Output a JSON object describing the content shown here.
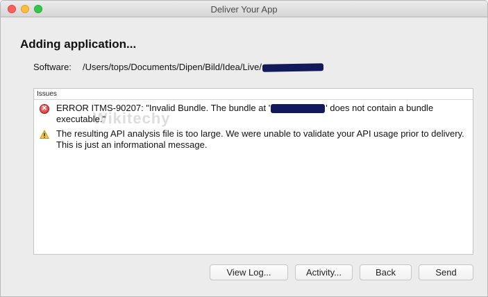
{
  "window": {
    "title": "Deliver Your App"
  },
  "heading": "Adding application...",
  "software": {
    "label": "Software:",
    "path": "/Users/tops/Documents/Dipen/Bild/Idea/Live/"
  },
  "issues": {
    "header": "Issues",
    "items": [
      {
        "type": "error",
        "icon": "error-icon",
        "text_before": "ERROR ITMS-90207: \"Invalid Bundle. The bundle at '",
        "text_after": "' does not contain a bundle executable.\""
      },
      {
        "type": "warning",
        "icon": "warning-icon",
        "text": "The resulting API analysis file is too large.  We were unable to validate your API usage prior to delivery.  This is just an informational message."
      }
    ]
  },
  "watermark": "Wikitechy",
  "buttons": {
    "view_log": "View Log...",
    "activity": "Activity...",
    "back": "Back",
    "send": "Send"
  },
  "colors": {
    "error": "#d21f1f",
    "warning": "#f5c542",
    "redaction": "#121a5c"
  }
}
